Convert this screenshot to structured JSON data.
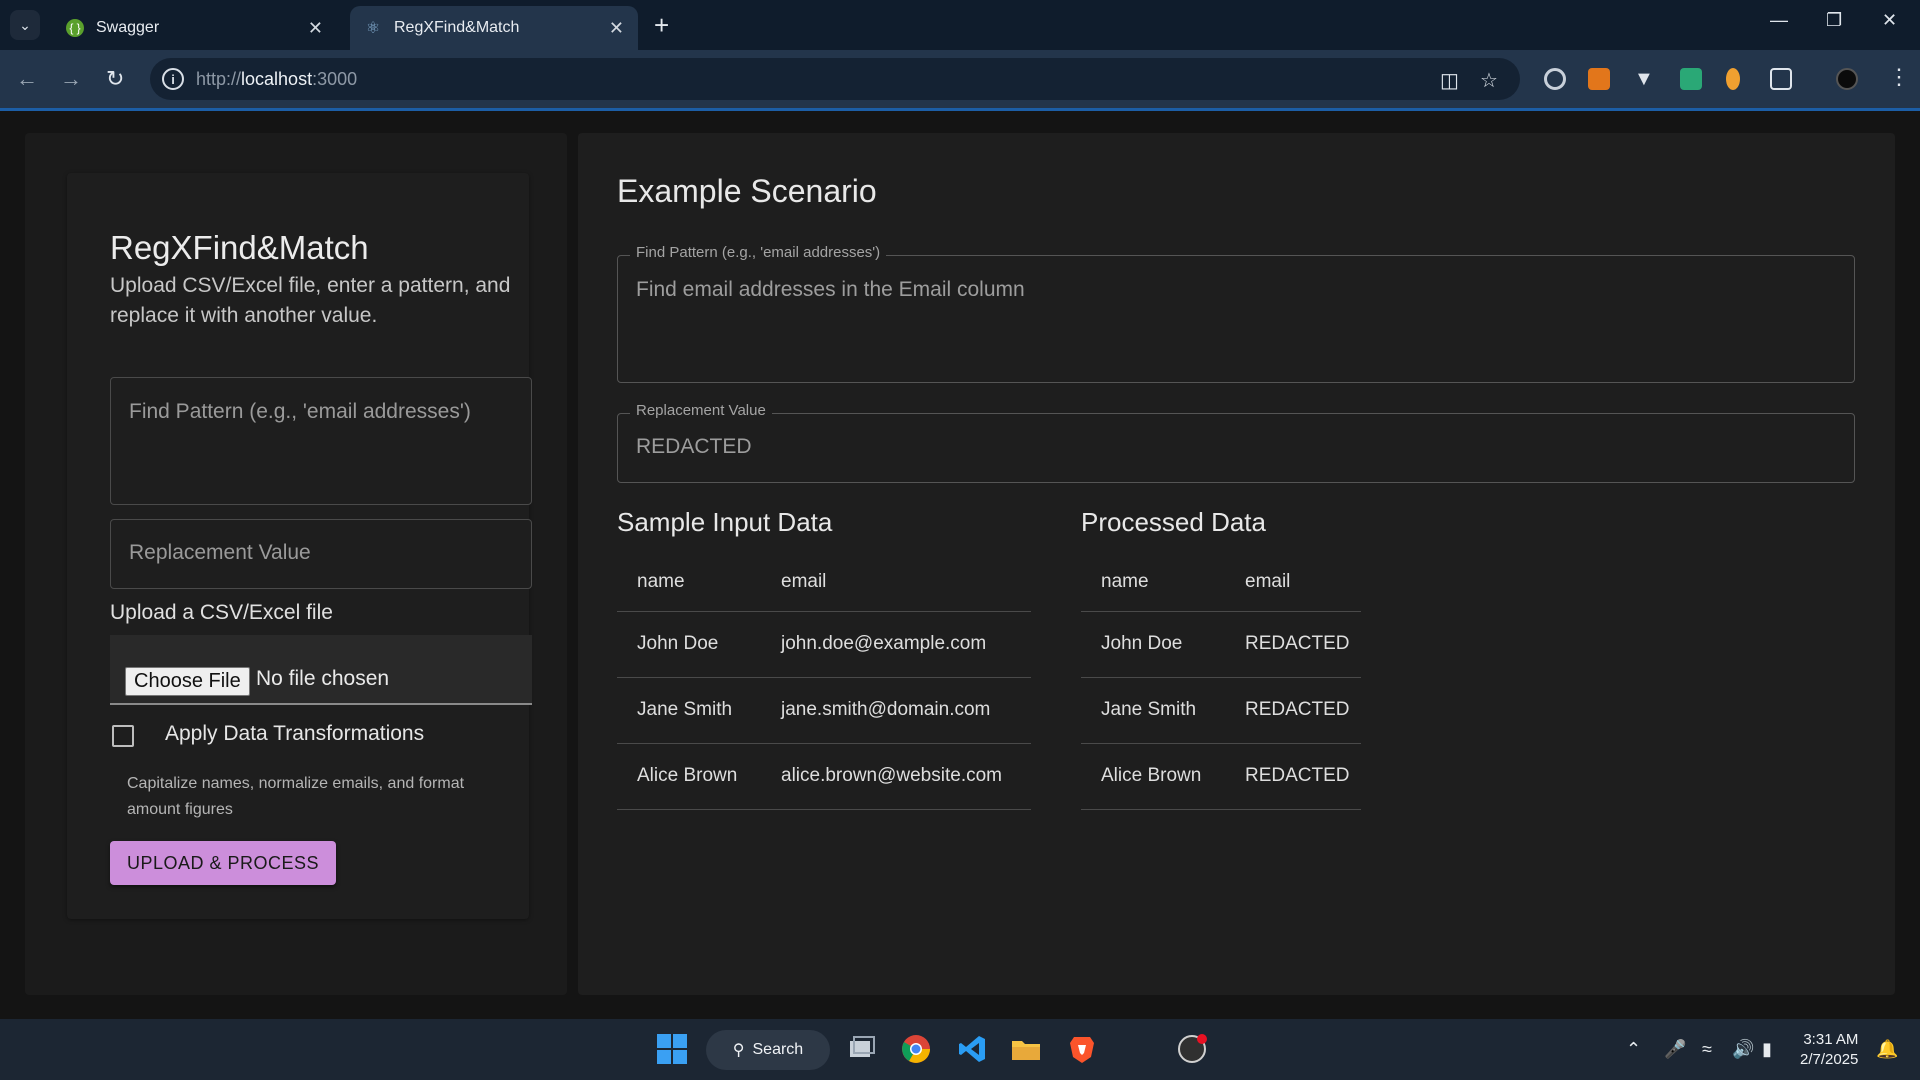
{
  "browser": {
    "tabs": [
      {
        "title": "Swagger",
        "icon": "swagger-icon"
      },
      {
        "title": "RegXFind&Match",
        "icon": "react-icon",
        "active": true
      }
    ],
    "url_prefix": "http://",
    "url_host": "localhost",
    "url_port": ":3000"
  },
  "app": {
    "title": "RegXFind&Match",
    "subtitle": "Upload CSV/Excel file, enter a pattern, and replace it with another value.",
    "find_placeholder": "Find Pattern (e.g., 'email addresses')",
    "replace_placeholder": "Replacement Value",
    "file_label": "Upload a CSV/Excel file",
    "choose_file": "Choose File",
    "no_file": "No file chosen",
    "checkbox_label": "Apply Data Transformations",
    "checkbox_checked": false,
    "helper": "Capitalize names, normalize emails, and format amount figures",
    "upload_button": "UPLOAD & PROCESS",
    "accent_color": "#cc8edb"
  },
  "example": {
    "title": "Example Scenario",
    "find_legend": "Find Pattern (e.g., 'email addresses')",
    "find_value": "Find email addresses in the Email column",
    "replace_legend": "Replacement Value",
    "replace_value": "REDACTED",
    "input_title": "Sample Input Data",
    "output_title": "Processed Data",
    "columns": [
      "name",
      "email"
    ],
    "input_rows": [
      [
        "John Doe",
        "john.doe@example.com"
      ],
      [
        "Jane Smith",
        "jane.smith@domain.com"
      ],
      [
        "Alice Brown",
        "alice.brown@website.com"
      ]
    ],
    "output_rows": [
      [
        "John Doe",
        "REDACTED"
      ],
      [
        "Jane Smith",
        "REDACTED"
      ],
      [
        "Alice Brown",
        "REDACTED"
      ]
    ]
  },
  "taskbar": {
    "search_label": "Search",
    "time": "3:31 AM",
    "date": "2/7/2025"
  }
}
